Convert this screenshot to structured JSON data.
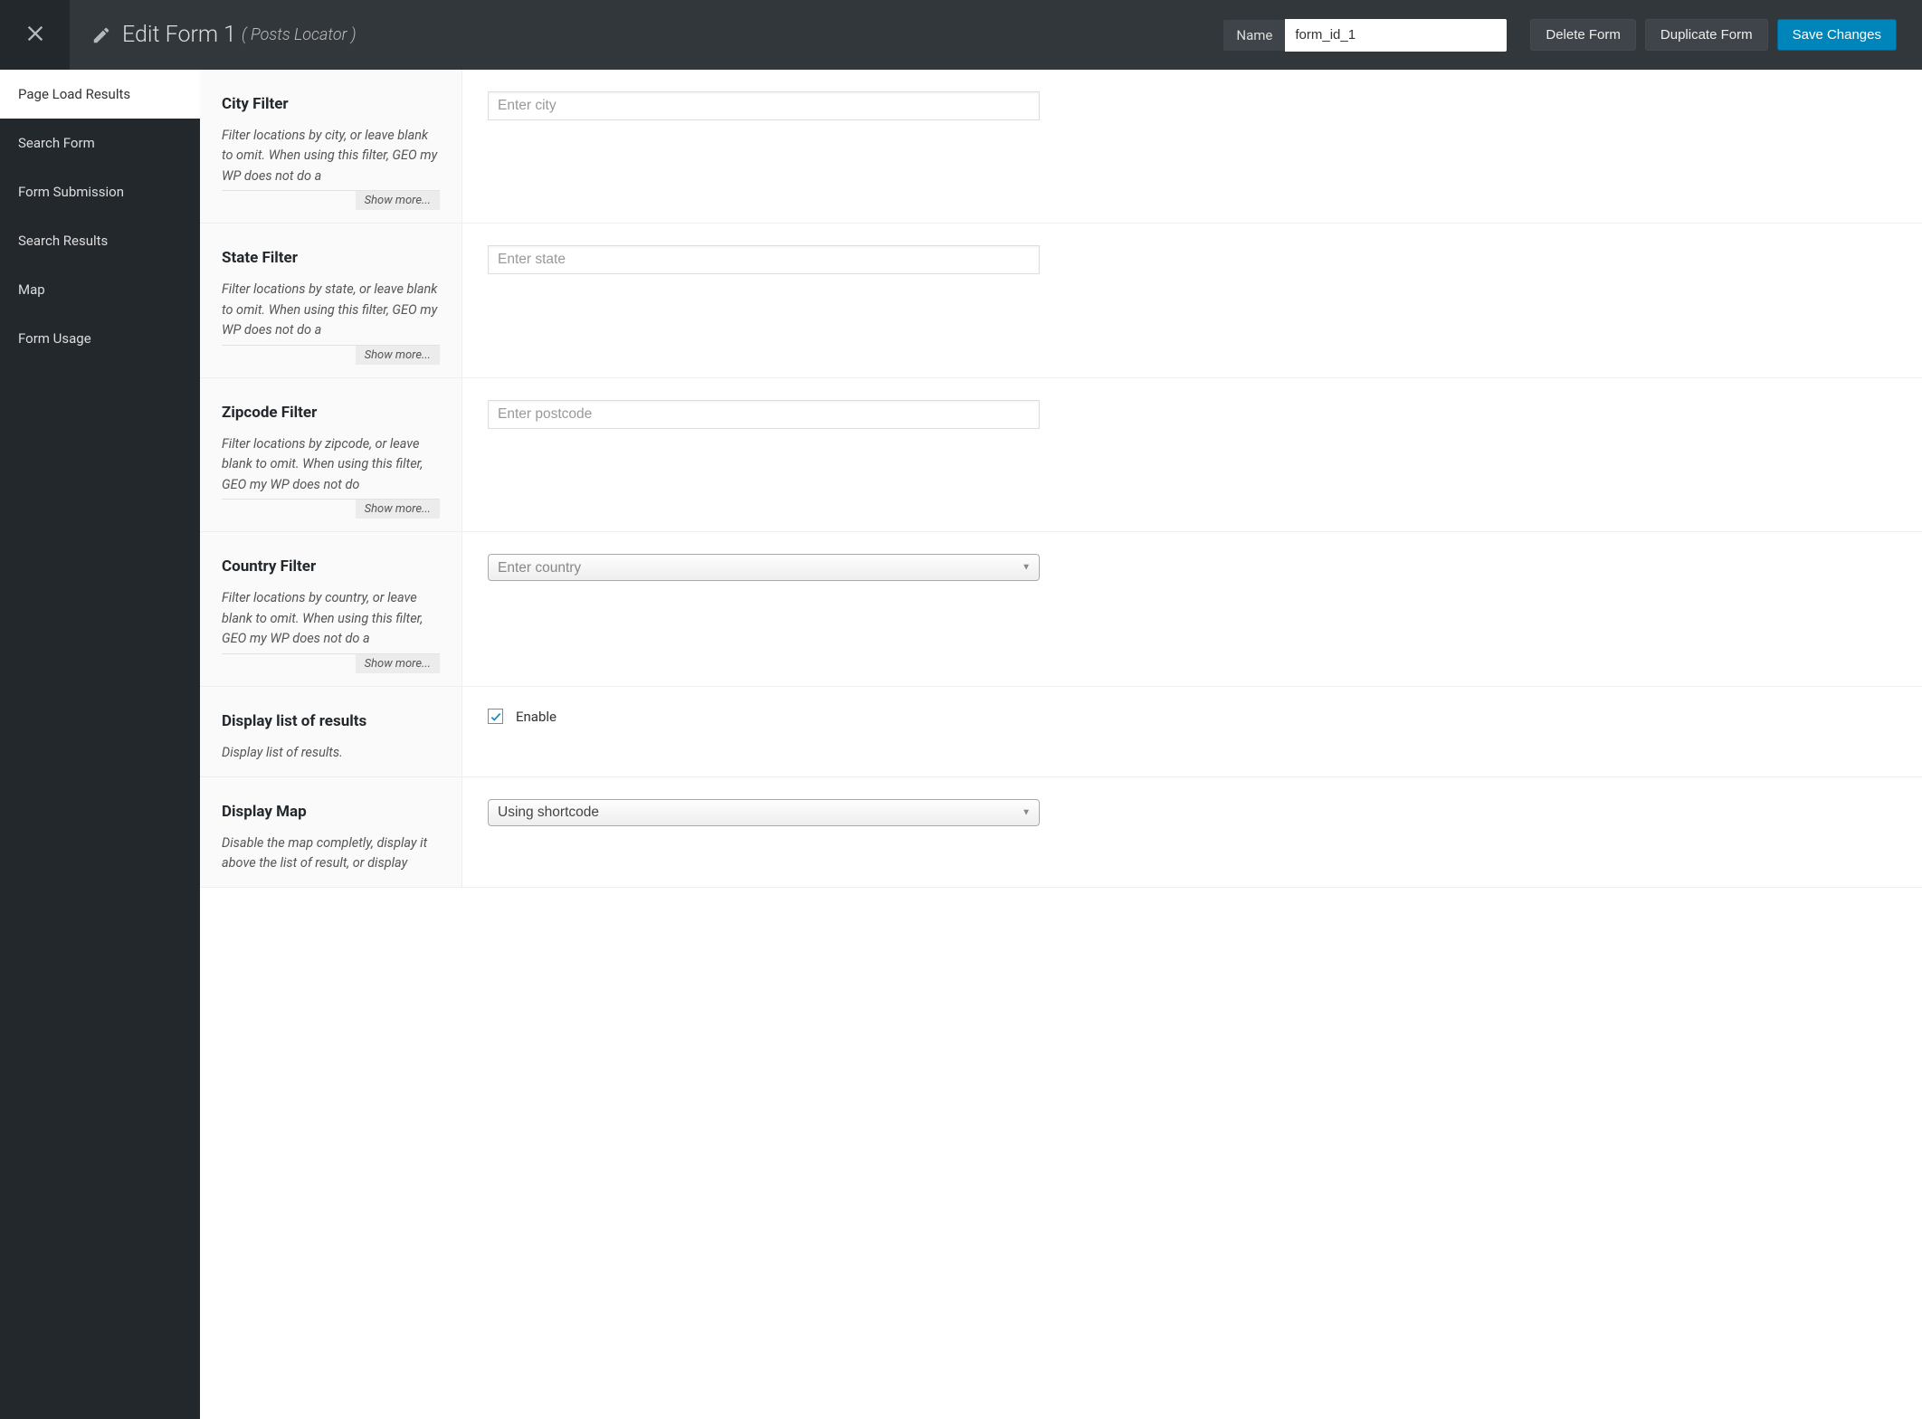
{
  "header": {
    "title": "Edit Form 1",
    "subtitle": "( Posts Locator )",
    "name_label": "Name",
    "name_value": "form_id_1",
    "delete_label": "Delete Form",
    "duplicate_label": "Duplicate Form",
    "save_label": "Save Changes"
  },
  "sidebar": {
    "items": [
      {
        "label": "Page Load Results",
        "active": true
      },
      {
        "label": "Search Form"
      },
      {
        "label": "Form Submission"
      },
      {
        "label": "Search Results"
      },
      {
        "label": "Map"
      },
      {
        "label": "Form Usage"
      }
    ]
  },
  "show_more_label": "Show more...",
  "settings": [
    {
      "key": "city",
      "title": "City Filter",
      "desc": "Filter locations by city, or leave blank to omit. When using this filter, GEO my WP does not do a",
      "placeholder": "Enter city",
      "type": "text",
      "show_more": true
    },
    {
      "key": "state",
      "title": "State Filter",
      "desc": "Filter locations by state, or leave blank to omit. When using this filter, GEO my WP does not do a",
      "placeholder": "Enter state",
      "type": "text",
      "show_more": true
    },
    {
      "key": "zipcode",
      "title": "Zipcode Filter",
      "desc": "Filter locations by zipcode, or leave blank to omit. When using this filter, GEO my WP does not do",
      "placeholder": "Enter postcode",
      "type": "text",
      "show_more": true
    },
    {
      "key": "country",
      "title": "Country Filter",
      "desc": "Filter locations by country, or leave blank to omit. When using this filter, GEO my WP does not do a",
      "placeholder": "Enter country",
      "type": "select",
      "show_more": true
    },
    {
      "key": "display_results",
      "title": "Display list of results",
      "desc": "Display list of results.",
      "type": "checkbox",
      "checkbox_label": "Enable",
      "checked": true,
      "show_more": false
    },
    {
      "key": "display_map",
      "title": "Display Map",
      "desc": "Disable the map completly, display it above the list of result, or display",
      "type": "select",
      "value": "Using shortcode",
      "show_more": false
    }
  ]
}
